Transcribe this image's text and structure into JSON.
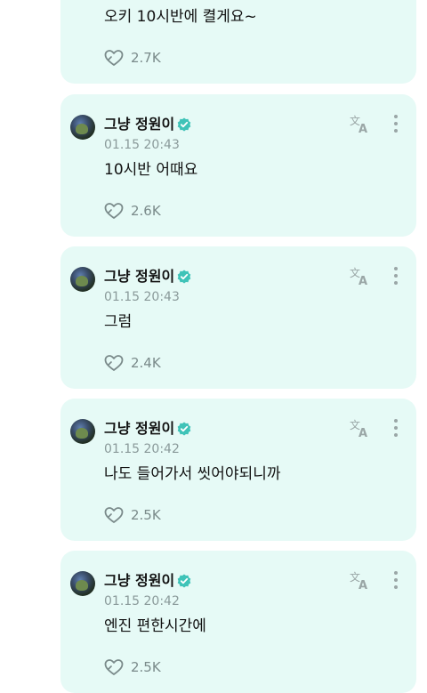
{
  "colors": {
    "card_bg": "#e6faf6",
    "verified": "#3fc3b8",
    "muted": "#8a9a9a"
  },
  "icons": {
    "verified": "verified-badge-icon",
    "translate": "translate-icon",
    "more": "more-vertical-icon",
    "like": "heart-like-icon"
  },
  "top_card": {
    "message": "오키 10시반에 켤게요~",
    "likes": "2.7K"
  },
  "posts": [
    {
      "author": "그냥 정원이",
      "timestamp": "01.15 20:43",
      "message": "10시반 어때요",
      "likes": "2.6K"
    },
    {
      "author": "그냥 정원이",
      "timestamp": "01.15 20:43",
      "message": "그럼",
      "likes": "2.4K"
    },
    {
      "author": "그냥 정원이",
      "timestamp": "01.15 20:42",
      "message": "나도 들어가서 씻어야되니까",
      "likes": "2.5K"
    },
    {
      "author": "그냥 정원이",
      "timestamp": "01.15 20:42",
      "message": "엔진 편한시간에",
      "likes": "2.5K"
    }
  ]
}
